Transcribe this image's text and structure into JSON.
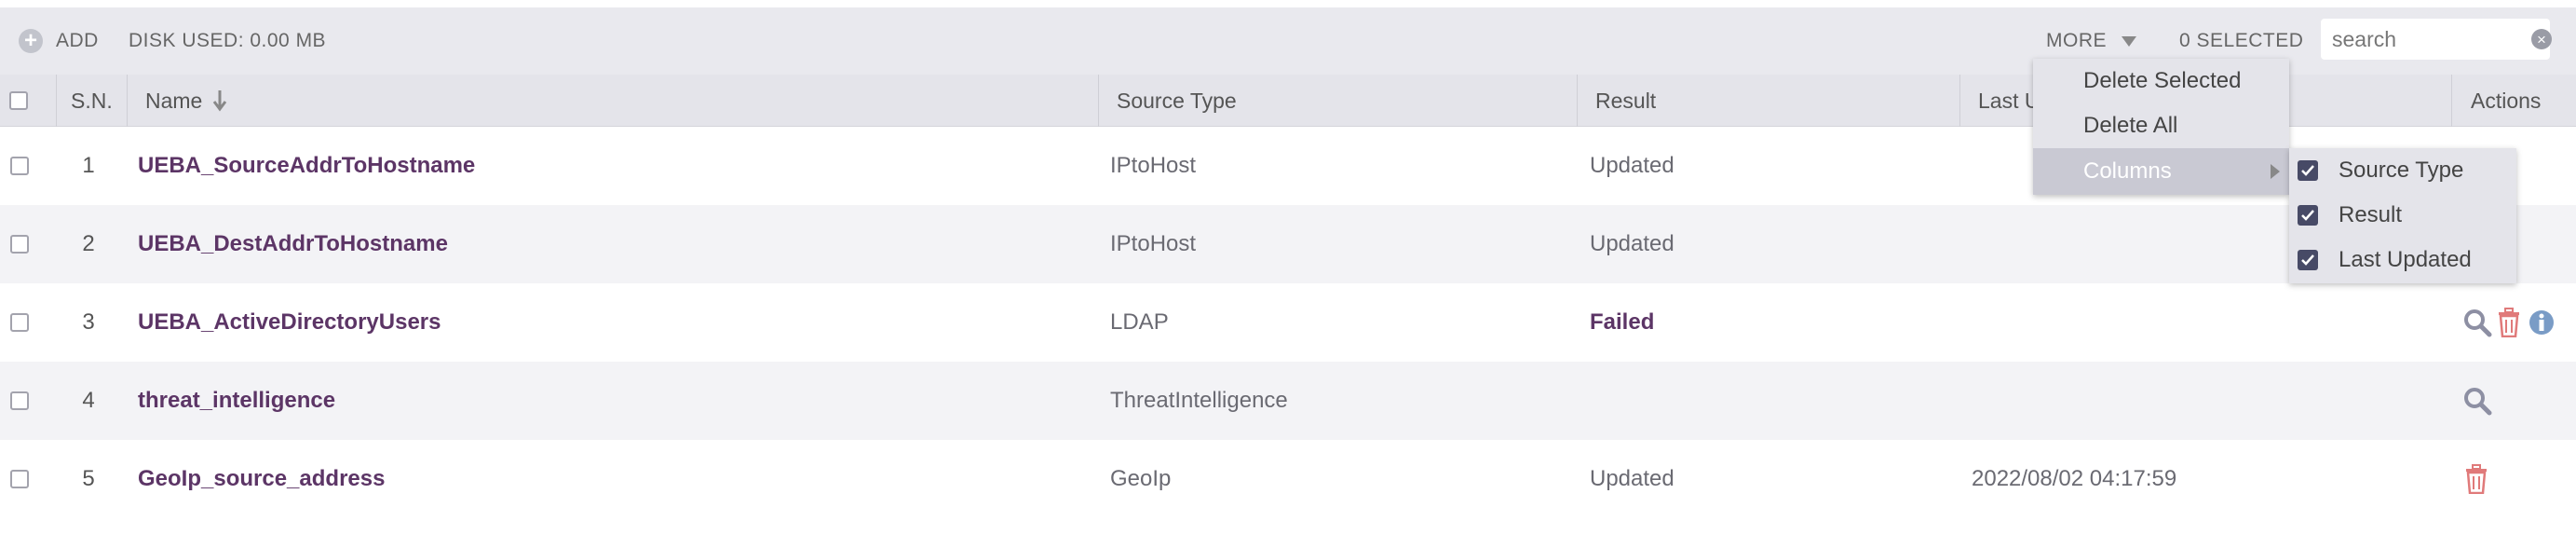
{
  "toolbar": {
    "add_label": "ADD",
    "disk_used": "DISK USED: 0.00 MB",
    "more_label": "MORE",
    "selected_count": "0 SELECTED",
    "search_placeholder": "search"
  },
  "table": {
    "headers": {
      "sn": "S.N.",
      "name": "Name",
      "source_type": "Source Type",
      "result": "Result",
      "last_updated": "Last U",
      "actions": "Actions"
    },
    "rows": [
      {
        "sn": "1",
        "name": "UEBA_SourceAddrToHostname",
        "source_type": "IPtoHost",
        "result": "Updated",
        "last_updated": "",
        "actions": []
      },
      {
        "sn": "2",
        "name": "UEBA_DestAddrToHostname",
        "source_type": "IPtoHost",
        "result": "Updated",
        "last_updated": "",
        "actions": []
      },
      {
        "sn": "3",
        "name": "UEBA_ActiveDirectoryUsers",
        "source_type": "LDAP",
        "result": "Failed",
        "last_updated": "",
        "actions": [
          "search-icon",
          "trash-icon",
          "info-icon"
        ]
      },
      {
        "sn": "4",
        "name": "threat_intelligence",
        "source_type": "ThreatIntelligence",
        "result": "",
        "last_updated": "",
        "actions": [
          "search-icon"
        ]
      },
      {
        "sn": "5",
        "name": "GeoIp_source_address",
        "source_type": "GeoIp",
        "result": "Updated",
        "last_updated": "2022/08/02 04:17:59",
        "actions": [
          "trash-icon"
        ]
      }
    ]
  },
  "more_menu": {
    "items": [
      "Delete Selected",
      "Delete All",
      "Columns"
    ],
    "columns_submenu": [
      {
        "label": "Source Type",
        "checked": true
      },
      {
        "label": "Result",
        "checked": true
      },
      {
        "label": "Last Updated",
        "checked": true
      }
    ]
  },
  "colors": {
    "name_link": "#5c3566",
    "toolbar_bg": "#e9e9ee",
    "header_bg": "#e4e4ea",
    "checkbox_checked": "#474a66",
    "trash_icon": "#e07a7a",
    "search_icon": "#8d8fa3",
    "info_icon": "#7a9cc6"
  }
}
